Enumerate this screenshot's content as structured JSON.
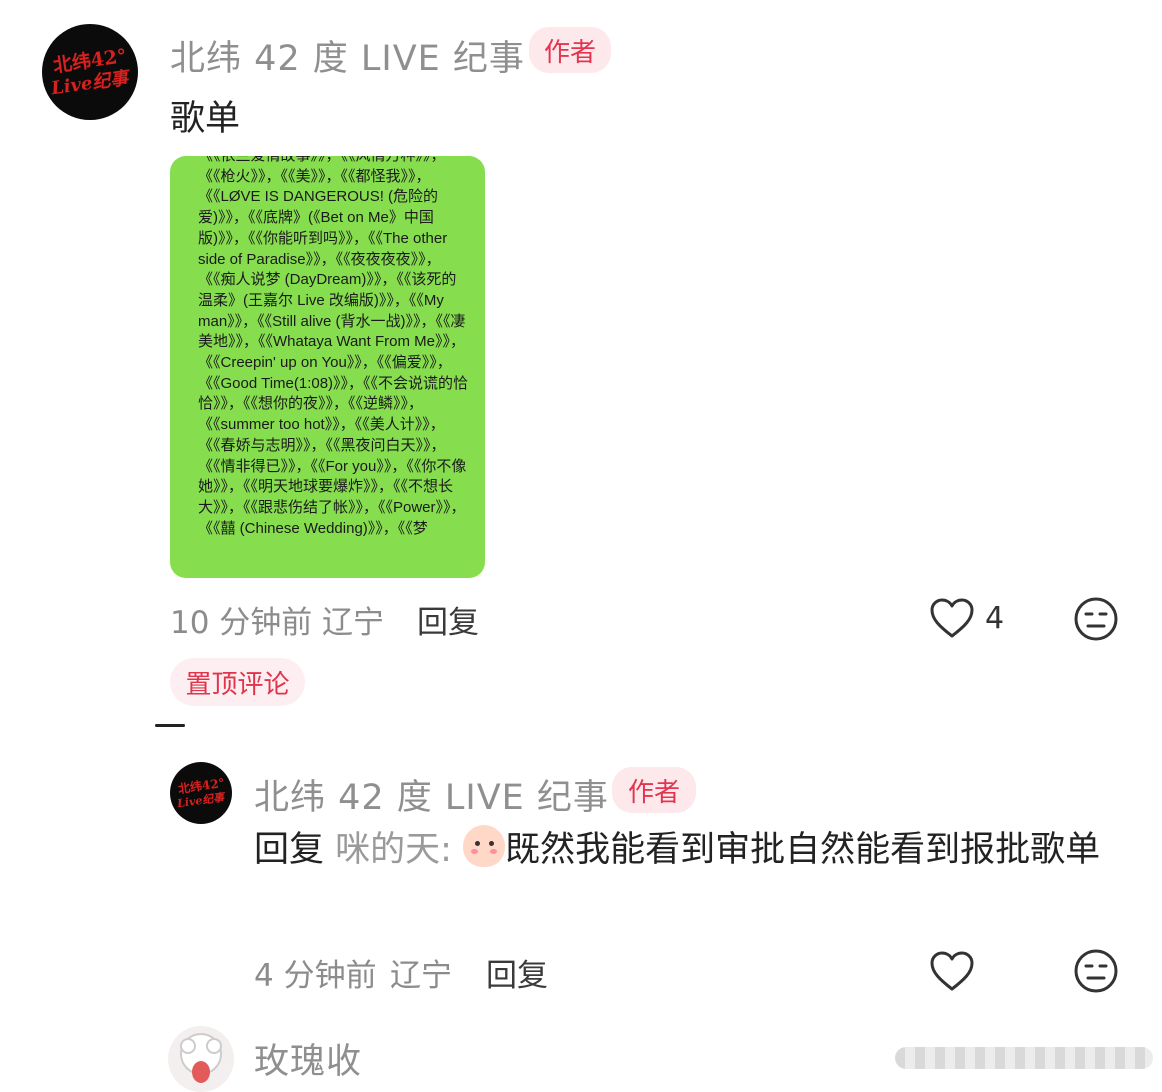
{
  "comment": {
    "author": "北纬 42 度 LIVE 纪事",
    "badge": "作者",
    "text": "歌单",
    "avatar_text_line1": "北纬42°",
    "avatar_text_line2": "Live纪事",
    "image_text": "《《依兰爱情故事》》，《《风情万种》》，《《枪火》》，《《美》》，《《都怪我》》，《《LØVE IS DANGEROUS! (危险的爱)》》，《《底牌》(《Bet on Me》中国版)》》，《《你能听到吗》》，《《The other side of Paradise》》，《《夜夜夜夜》》，《《痴人说梦 (DayDream)》》，《《该死的温柔》(王嘉尔 Live 改编版)》》，《《My man》》，《《Still alive (背水一战)》》，《《凄美地》》，《《Whataya Want From Me》》，《《Creepin' up on You》》，《《偏爱》》，《《Good Time(1:08)》》，《《不会说谎的恰恰》》，《《想你的夜》》，《《逆鳞》》，《《summer too hot》》，《《美人计》》，《《春娇与志明》》，《《黑夜问白天》》，《《情非得已》》，《《For you》》，《《你不像她》》，《《明天地球要爆炸》》，《《不想长大》》，《《跟悲伤结了帐》》，《《Power》》，《《囍 (Chinese Wedding)》》，《《梦",
    "time": "10 分钟前",
    "location": "辽宁",
    "reply_label": "回复",
    "like_count": "4",
    "pinned_label": "置顶评论"
  },
  "reply": {
    "author": "北纬 42 度 LIVE 纪事",
    "badge": "作者",
    "prefix": "回复",
    "target": "咪的天:",
    "text": "既然我能看到审批自然能看到报批歌单",
    "time": "4 分钟前",
    "location": "辽宁",
    "reply_label": "回复"
  },
  "next_comment": {
    "author": "玫瑰收"
  },
  "colors": {
    "badge_text": "#e4344f",
    "badge_bg": "#fde8ec",
    "image_bg": "#86dd4e",
    "avatar_bg": "#0b0b0b",
    "avatar_text": "#d8201e"
  },
  "icons": {
    "like": "heart-outline-icon",
    "dislike": "neutral-face-icon",
    "emoji": "peach-face-emoji"
  }
}
